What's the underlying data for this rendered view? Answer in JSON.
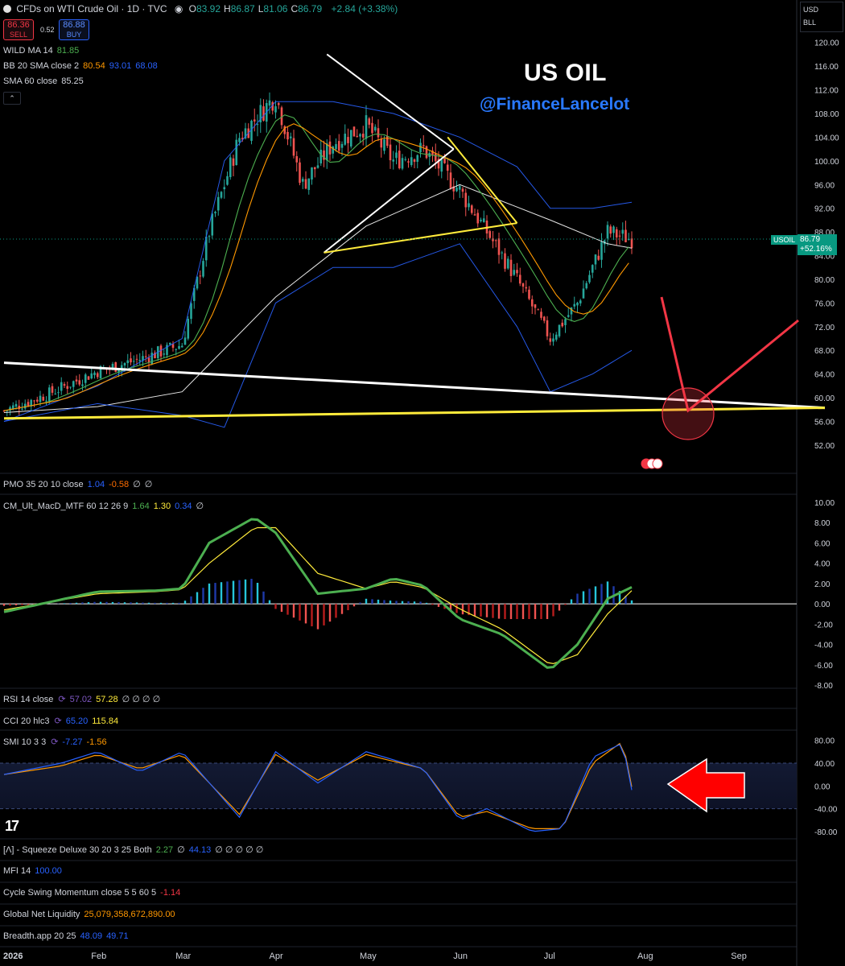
{
  "header": {
    "symbol_title": "CFDs on WTI Crude Oil · 1D · TVC",
    "ohlc": [
      {
        "k": "O",
        "v": "83.92"
      },
      {
        "k": "H",
        "v": "86.87"
      },
      {
        "k": "L",
        "v": "81.06"
      },
      {
        "k": "C",
        "v": "86.79"
      }
    ],
    "change": "+2.84 (+3.38%)",
    "sell_price": "86.36",
    "sell_label": "SELL",
    "spread": "0.52",
    "buy_price": "86.88",
    "buy_label": "BUY"
  },
  "currency": {
    "top": "USD",
    "unit": "BLL"
  },
  "indicators_main": [
    {
      "name": "WILD MA 14",
      "values": [
        {
          "v": "81.85",
          "c": "#4caf50"
        }
      ]
    },
    {
      "name": "BB 20 SMA close 2",
      "values": [
        {
          "v": "80.54",
          "c": "#ff9800"
        },
        {
          "v": "93.01",
          "c": "#2962ff"
        },
        {
          "v": "68.08",
          "c": "#2962ff"
        }
      ]
    },
    {
      "name": "SMA 60 close",
      "values": [
        {
          "v": "85.25",
          "c": "#d1d4dc"
        }
      ]
    }
  ],
  "annotation": {
    "title": "US OIL",
    "handle": "@FinanceLancelot"
  },
  "price_label": {
    "symbol": "USOIL",
    "price": "86.79",
    "pct": "+52.16%"
  },
  "pmo": {
    "name": "PMO 35 20 10 close",
    "values": [
      {
        "v": "1.04",
        "c": "#2962ff"
      },
      {
        "v": "-0.58",
        "c": "#ff6d00"
      },
      {
        "v": "∅",
        "c": "#d1d4dc"
      },
      {
        "v": "∅",
        "c": "#d1d4dc"
      }
    ]
  },
  "macd": {
    "name": "CM_Ult_MacD_MTF 60 12 26 9",
    "values": [
      {
        "v": "1.64",
        "c": "#4caf50"
      },
      {
        "v": "1.30",
        "c": "#ffeb3b"
      },
      {
        "v": "0.34",
        "c": "#2962ff"
      },
      {
        "v": "∅",
        "c": "#d1d4dc"
      }
    ]
  },
  "rsi": {
    "name": "RSI 14 close",
    "values": [
      {
        "v": "57.02",
        "c": "#7e57c2"
      },
      {
        "v": "57.28",
        "c": "#ffeb3b"
      },
      {
        "v": "∅ ∅ ∅ ∅",
        "c": "#d1d4dc"
      }
    ]
  },
  "cci": {
    "name": "CCI 20 hlc3",
    "values": [
      {
        "v": "65.20",
        "c": "#2962ff"
      },
      {
        "v": "115.84",
        "c": "#ffeb3b"
      }
    ]
  },
  "smi": {
    "name": "SMI 10 3 3",
    "values": [
      {
        "v": "-7.27",
        "c": "#2962ff"
      },
      {
        "v": "-1.56",
        "c": "#ff9800"
      }
    ]
  },
  "bottom_indicators": [
    {
      "name": "[Λ] - Squeeze Deluxe 30 20 3 25 Both",
      "values": [
        {
          "v": "2.27",
          "c": "#4caf50"
        },
        {
          "v": "∅",
          "c": "#d1d4dc"
        },
        {
          "v": "44.13",
          "c": "#2962ff"
        },
        {
          "v": "∅ ∅ ∅ ∅ ∅",
          "c": "#d1d4dc"
        }
      ]
    },
    {
      "name": "MFI 14",
      "values": [
        {
          "v": "100.00",
          "c": "#2962ff"
        }
      ]
    },
    {
      "name": "Cycle Swing Momentum close 5 5 60 5",
      "values": [
        {
          "v": "-1.14",
          "c": "#f23645"
        }
      ]
    },
    {
      "name": "Global Net Liquidity",
      "values": [
        {
          "v": "25,079,358,672,890.00",
          "c": "#ff9800"
        }
      ]
    },
    {
      "name": "Breadth.app 20 25",
      "values": [
        {
          "v": "48.09",
          "c": "#2962ff"
        },
        {
          "v": "49.71",
          "c": "#2962ff"
        }
      ]
    }
  ],
  "chart_data": [
    {
      "type": "line",
      "title": "CFDs on WTI Crude Oil · 1D · TVC",
      "x_axis_labels": [
        "2026",
        "Feb",
        "Mar",
        "Apr",
        "May",
        "Jun",
        "Jul",
        "Aug",
        "Sep"
      ],
      "ylim": [
        49.5,
        121.5
      ],
      "y_ticks": [
        52,
        56,
        60,
        64,
        68,
        72,
        76,
        80,
        84,
        88,
        92,
        96,
        100,
        104,
        108,
        112,
        116,
        120
      ],
      "series": [
        {
          "name": "",
          "color": "#ffffff",
          "x": [
            "2026-01-01",
            "2026-01-15",
            "2026-02-01",
            "2026-02-15",
            "2026-03-01",
            "2026-03-10",
            "2026-03-20",
            "2026-04-01",
            "2026-04-10",
            "2026-04-20",
            "2026-05-01",
            "2026-05-10",
            "2026-05-20",
            "2026-06-01",
            "2026-06-10",
            "2026-06-20",
            "2026-07-01",
            "2026-07-10",
            "2026-07-20",
            "2026-07-28"
          ],
          "y": [
            57.8,
            60.5,
            64.5,
            66.5,
            69,
            88,
            104,
            111,
            96,
            103,
            106,
            100,
            102,
            95,
            88,
            80,
            70,
            76,
            88,
            86.8
          ]
        },
        {
          "name": "",
          "color": "#ffffff",
          "x": [
            "2026-01-01",
            "2026-02-01",
            "2026-03-01",
            "2026-04-01",
            "2026-05-01",
            "2026-06-01",
            "2026-07-01",
            "2026-07-20",
            "2026-07-28"
          ],
          "y": [
            57.5,
            58.5,
            61,
            77,
            89,
            96,
            90,
            86,
            85.25
          ]
        },
        {
          "name": "",
          "color": "#2962ff",
          "x": [
            "2026-01-01",
            "2026-02-01",
            "2026-03-01",
            "2026-03-15",
            "2026-04-01",
            "2026-04-20",
            "2026-05-10",
            "2026-06-01",
            "2026-06-20",
            "2026-07-01",
            "2026-07-15",
            "2026-07-28"
          ],
          "y": [
            56,
            62,
            70,
            100,
            110,
            110,
            108,
            104,
            99,
            92,
            92,
            93
          ]
        },
        {
          "name": "",
          "color": "#2962ff",
          "x": [
            "2026-01-01",
            "2026-02-01",
            "2026-03-01",
            "2026-03-15",
            "2026-04-01",
            "2026-04-20",
            "2026-05-10",
            "2026-06-01",
            "2026-06-20",
            "2026-07-01",
            "2026-07-15",
            "2026-07-28"
          ],
          "y": [
            56,
            59,
            57,
            55,
            76,
            82,
            82,
            86,
            72,
            61,
            64,
            68
          ]
        }
      ],
      "trendlines": [
        {
          "color": "#ffffff",
          "from": [
            "2026-01-01",
            65.9
          ],
          "to": [
            "2026-09-30",
            58.3
          ]
        },
        {
          "color": "#ffeb3b",
          "from": [
            "2026-01-01",
            56.5
          ],
          "to": [
            "2026-09-30",
            58.3
          ]
        },
        {
          "color": "#ffffff",
          "from": [
            "2026-04-17",
            84.5
          ],
          "to": [
            "2026-05-30",
            102
          ]
        },
        {
          "color": "#ffffff",
          "from": [
            "2026-04-18",
            118
          ],
          "to": [
            "2026-05-30",
            102
          ]
        },
        {
          "color": "#ffeb3b",
          "from": [
            "2026-04-17",
            84.5
          ],
          "to": [
            "2026-06-20",
            89.5
          ]
        },
        {
          "color": "#ffeb3b",
          "from": [
            "2026-05-28",
            104
          ],
          "to": [
            "2026-06-20",
            89.5
          ]
        }
      ],
      "last_price": 86.79
    },
    {
      "type": "bar",
      "title": "CM_Ult_MacD_MTF 60 12 26 9",
      "ylim": [
        -8,
        10
      ],
      "y_ticks": [
        -8,
        -6,
        -4,
        -2,
        0,
        2,
        4,
        6,
        8,
        10
      ],
      "x": [
        "2026-01-01",
        "2026-02-01",
        "2026-02-20",
        "2026-03-01",
        "2026-03-10",
        "2026-03-25",
        "2026-04-01",
        "2026-04-15",
        "2026-05-01",
        "2026-05-10",
        "2026-05-20",
        "2026-06-01",
        "2026-06-15",
        "2026-07-01",
        "2026-07-10",
        "2026-07-20",
        "2026-07-28"
      ],
      "series": [
        {
          "name": "",
          "values": [
            -0.8,
            1.2,
            1.3,
            1.5,
            6,
            8.5,
            7,
            1,
            1.5,
            2.5,
            1.8,
            -1.5,
            -3,
            -6.5,
            -4,
            0.5,
            1.64
          ]
        },
        {
          "name": "",
          "values": [
            -0.6,
            1.0,
            1.2,
            1.4,
            4,
            7.5,
            7.5,
            3,
            1.5,
            2.2,
            1.6,
            -0.5,
            -2.5,
            -6,
            -5,
            -1,
            1.3
          ]
        },
        {
          "name": "",
          "values": [
            -0.2,
            0.2,
            0.1,
            0.1,
            2,
            2.5,
            -0.5,
            -2.5,
            0.5,
            0.3,
            0.2,
            -1,
            -1.5,
            -1.5,
            1,
            2.2,
            0.34
          ]
        }
      ]
    },
    {
      "type": "line",
      "title": "SMI 10 3 3",
      "ylim": [
        -90,
        95
      ],
      "y_ticks": [
        -80,
        -40,
        0,
        40,
        80
      ],
      "x": [
        "2026-01-01",
        "2026-01-20",
        "2026-02-01",
        "2026-02-15",
        "2026-03-01",
        "2026-03-20",
        "2026-04-01",
        "2026-04-15",
        "2026-05-01",
        "2026-05-20",
        "2026-06-01",
        "2026-06-10",
        "2026-06-25",
        "2026-07-05",
        "2026-07-15",
        "2026-07-25",
        "2026-07-28"
      ],
      "series": [
        {
          "name": "",
          "values": [
            20,
            40,
            60,
            25,
            60,
            -55,
            60,
            5,
            60,
            30,
            -60,
            -40,
            -80,
            -75,
            50,
            75,
            -7.27
          ]
        },
        {
          "name": "",
          "values": [
            20,
            35,
            55,
            30,
            55,
            -50,
            55,
            10,
            55,
            30,
            -55,
            -45,
            -75,
            -75,
            40,
            78,
            -1.56
          ]
        }
      ]
    }
  ]
}
